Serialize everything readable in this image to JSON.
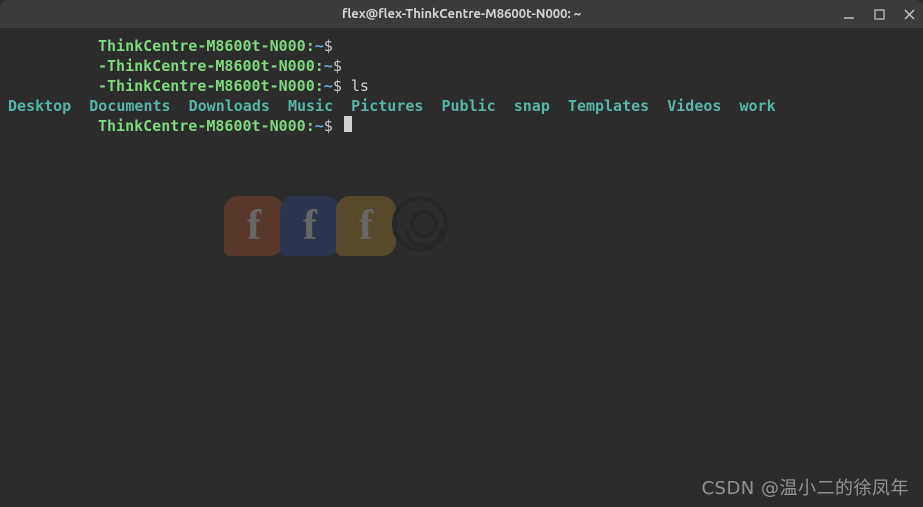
{
  "titlebar": {
    "title": "flex@flex-ThinkCentre-M8600t-N000: ~"
  },
  "prompt": {
    "host_suffix": "ThinkCentre-M8600t-N000",
    "sep1": ":",
    "path": "~",
    "symbol": "$"
  },
  "lines": {
    "cmd_ls": " ls"
  },
  "ls_output": "Desktop  Documents  Downloads  Music  Pictures  Public  snap  Templates  Videos  work",
  "watermark": "CSDN @温小二的徐凤年"
}
